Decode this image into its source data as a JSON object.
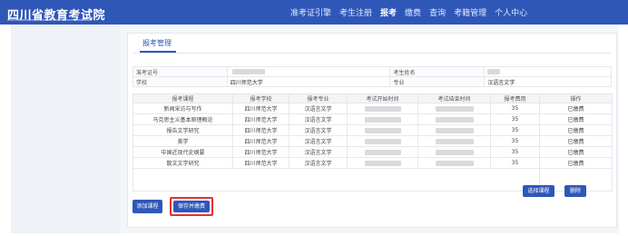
{
  "brand": {
    "title": "四川省教育考试院"
  },
  "nav": {
    "items": [
      "准考证引擎",
      "考生注册",
      "报考",
      "缴费",
      "查询",
      "考籍管理",
      "个人中心"
    ],
    "active_index": 2
  },
  "tab": {
    "label": "报考管理"
  },
  "info": {
    "exam_no_label": "准考证号",
    "name_label": "考生姓名",
    "school_label": "学校",
    "school_value": "四川师范大学",
    "major_label": "专业",
    "major_value": "汉语言文学"
  },
  "table": {
    "headers": [
      "报考课程",
      "报考学校",
      "报考专业",
      "考试开始时间",
      "考试结束时间",
      "报考费用",
      "操作"
    ],
    "rows": [
      {
        "course": "新闻采访与写作",
        "school": "四川师范大学",
        "major": "汉语言文学",
        "fee": "35",
        "status": "已缴费"
      },
      {
        "course": "马克思主义基本原理概论",
        "school": "四川师范大学",
        "major": "汉语言文学",
        "fee": "35",
        "status": "已缴费"
      },
      {
        "course": "报告文学研究",
        "school": "四川师范大学",
        "major": "汉语言文学",
        "fee": "35",
        "status": "已缴费"
      },
      {
        "course": "美学",
        "school": "四川师范大学",
        "major": "汉语言文学",
        "fee": "35",
        "status": "已缴费"
      },
      {
        "course": "中国近现代史纲要",
        "school": "四川师范大学",
        "major": "汉语言文学",
        "fee": "35",
        "status": "已缴费"
      },
      {
        "course": "散文文学研究",
        "school": "四川师范大学",
        "major": "汉语言文学",
        "fee": "35",
        "status": "已缴费"
      }
    ]
  },
  "buttons": {
    "select_course": "选择课程",
    "delete": "删除",
    "add_course": "添加课程",
    "save_submit": "保存并缴费"
  },
  "colors": {
    "primary": "#2f57b8",
    "highlight": "#e53030"
  }
}
